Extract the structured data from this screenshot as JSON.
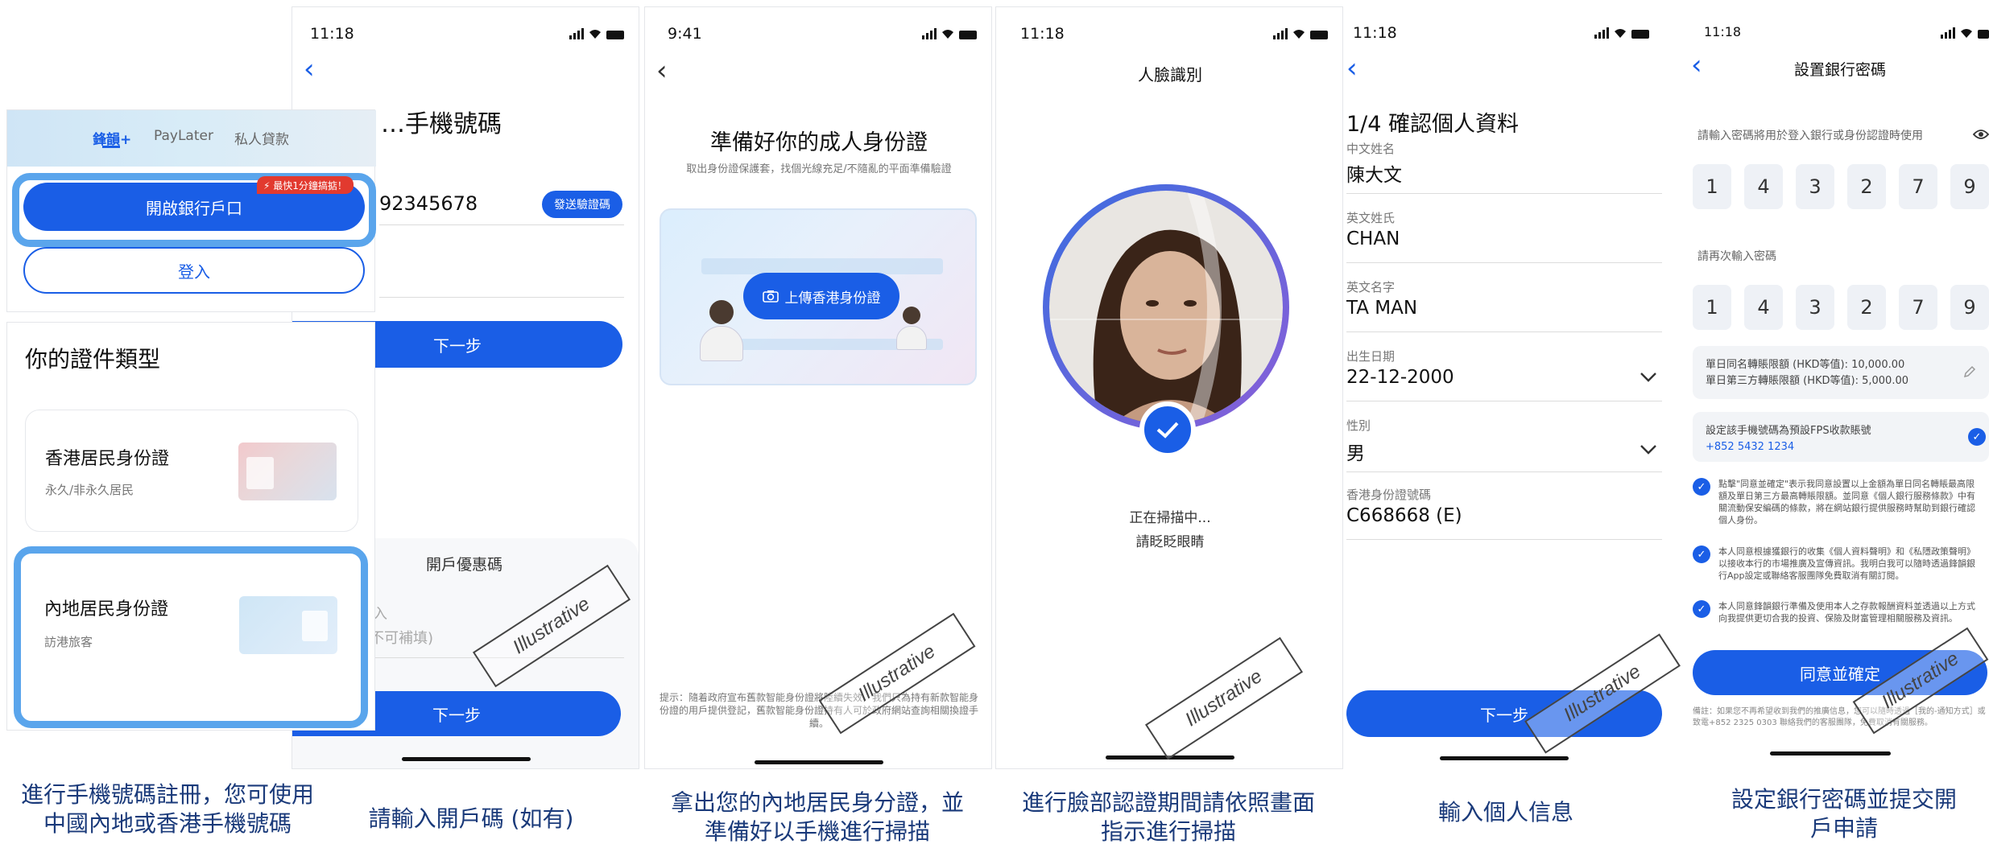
{
  "screen1": {
    "tabs": [
      "鋒韻+",
      "PayLater",
      "私人貸款"
    ],
    "badge": "⚡ 最快1分鐘搞掂！",
    "open_account": "開啟銀行戶口",
    "login": "登入",
    "doc_title": "你的證件類型",
    "doc_options": [
      {
        "title": "香港居民身份證",
        "subtitle": "永久/非永久居民"
      },
      {
        "title": "內地居民身份證",
        "subtitle": "訪港旅客"
      }
    ]
  },
  "screen2": {
    "time": "11:18",
    "title_partial": "…手機號碼",
    "phone_partial": "92345678",
    "send_code": "發送驗證碼",
    "next1": "下一步",
    "promo_title": "開戶優惠碼",
    "promo_line1": "入",
    "promo_line2": "不可補填)",
    "next2": "下一步"
  },
  "screen3": {
    "time": "9:41",
    "title": "準備好你的成人身份證",
    "subtitle": "取出身份證保護套，找個光線充足/不隨亂的平面準備驗證",
    "upload_btn": "上傳香港身份證",
    "footnote": "提示：隨着政府宣布舊款智能身份證將陸續失效，我們只為持有新款智能身份證的用戶提供登記，舊款智能身份證持有人可於政府網站查詢相關換證手續。"
  },
  "screen4": {
    "time": "11:18",
    "title": "人臉識別",
    "scanning": "正在掃描中...",
    "blink": "請眨眨眼睛"
  },
  "screen5": {
    "time": "11:18",
    "title": "1/4 確認個人資料",
    "fields": [
      {
        "label": "中文姓名",
        "value": "陳大文"
      },
      {
        "label": "英文姓氏",
        "value": "CHAN"
      },
      {
        "label": "英文名字",
        "value": "TA MAN"
      },
      {
        "label": "出生日期",
        "value": "22-12-2000"
      },
      {
        "label": "性別",
        "value": "男"
      },
      {
        "label": "香港身份證號碼",
        "value": "C668668 (E)"
      }
    ],
    "next": "下一步"
  },
  "screen6": {
    "time": "11:18",
    "title": "設置銀行密碼",
    "pin_prompt": "請輸入密碼將用於登入銀行或身份認證時使用",
    "digits": [
      "1",
      "4",
      "3",
      "2",
      "7",
      "9"
    ],
    "confirm_prompt": "請再次輸入密碼",
    "limit1": "單日同名轉賬限額 (HKD等值): 10,000.00",
    "limit2": "單日第三方轉賬限額 (HKD等值): 5,000.00",
    "fps_label": "設定該手機號碼為預設FPS收款賬號",
    "fps_number": "+852 5432 1234",
    "consent1": "點擊\"同意並確定\"表示我同意設置以上金額為單日同名轉賬最高限額及單日第三方最高轉賬限額。並同意《個人銀行服務條款》中有關流動保安編碼的條款，將在網站銀行提供服務時幫助到銀行確認個人身份。",
    "consent2": "本人同意根據獲銀行的收集《個人資料聲明》和《私隱政策聲明》以接收本行的市場推廣及宣傳資訊。我明白我可以隨時透過鋒韻銀行App設定或聯絡客服團隊免費取消有關訂閱。",
    "consent3": "本人同意鋒韻銀行準備及使用本人之存款報酬資料並透過以上方式向我提供更切合我的投資、保險及財富管理相關服務及資訊。",
    "agree_btn": "同意並確定",
    "note": "備註：如果您不再希望收到我們的推廣信息，您可以隨時透過［我的-通知方式］或致電+852 2325 0303 聯絡我們的客服團隊，免費取消有關服務。"
  },
  "stamp": "Illustrative",
  "captions": [
    "進行手機號碼註冊，您可使用中國內地或香港手機號碼",
    "請輸入開戶碼 (如有)",
    "拿出您的內地居民身分證，並準備好以手機進行掃描",
    "進行臉部認證期間請依照畫面指示進行掃描",
    "輸入個人信息",
    "設定銀行密碼並提交開戶申請"
  ]
}
